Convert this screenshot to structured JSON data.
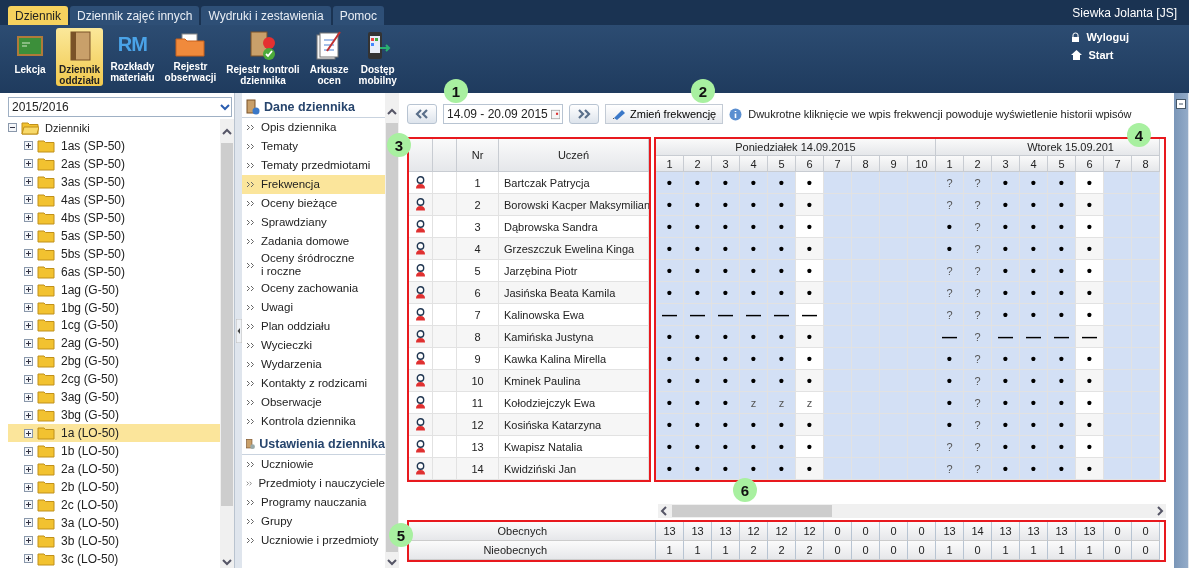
{
  "menu_tabs": [
    {
      "label": "Dziennik",
      "selected": true
    },
    {
      "label": "Dziennik zajęć innych",
      "selected": false
    },
    {
      "label": "Wydruki i zestawienia",
      "selected": false
    },
    {
      "label": "Pomoc",
      "selected": false
    }
  ],
  "user": {
    "name": "Siewka Jolanta [JS]",
    "links": [
      "Wyloguj",
      "Start"
    ]
  },
  "ribbon": [
    {
      "label_lines": [
        "Lekcja"
      ],
      "selected": false
    },
    {
      "label_lines": [
        "Dziennik",
        "oddziału"
      ],
      "selected": true
    },
    {
      "label_lines": [
        "Rozkłady",
        "materiału"
      ],
      "icon_text": "RM",
      "selected": false
    },
    {
      "label_lines": [
        "Rejestr",
        "obserwacji"
      ],
      "selected": false
    },
    {
      "label_lines": [
        "Rejestr kontroli",
        "dziennika"
      ],
      "selected": false
    },
    {
      "label_lines": [
        "Arkusze",
        "ocen"
      ],
      "selected": false
    },
    {
      "label_lines": [
        "Dostęp",
        "mobilny"
      ],
      "selected": false
    }
  ],
  "year_select": {
    "value": "2015/2016"
  },
  "tree": {
    "label": "Dzienniki",
    "expanded": true,
    "children": [
      {
        "label": "1as (SP-50)",
        "expanded": false,
        "selected": false
      },
      {
        "label": "2as (SP-50)",
        "expanded": false,
        "selected": false
      },
      {
        "label": "3as (SP-50)",
        "expanded": false,
        "selected": false
      },
      {
        "label": "4as (SP-50)",
        "expanded": false,
        "selected": false
      },
      {
        "label": "4bs (SP-50)",
        "expanded": false,
        "selected": false
      },
      {
        "label": "5as (SP-50)",
        "expanded": false,
        "selected": false
      },
      {
        "label": "5bs (SP-50)",
        "expanded": false,
        "selected": false
      },
      {
        "label": "6as (SP-50)",
        "expanded": false,
        "selected": false
      },
      {
        "label": "1ag (G-50)",
        "expanded": false,
        "selected": false
      },
      {
        "label": "1bg (G-50)",
        "expanded": false,
        "selected": false
      },
      {
        "label": "1cg (G-50)",
        "expanded": false,
        "selected": false
      },
      {
        "label": "2ag (G-50)",
        "expanded": false,
        "selected": false
      },
      {
        "label": "2bg (G-50)",
        "expanded": false,
        "selected": false
      },
      {
        "label": "2cg (G-50)",
        "expanded": false,
        "selected": false
      },
      {
        "label": "3ag (G-50)",
        "expanded": false,
        "selected": false
      },
      {
        "label": "3bg (G-50)",
        "expanded": false,
        "selected": false
      },
      {
        "label": "1a (LO-50)",
        "expanded": false,
        "selected": true
      },
      {
        "label": "1b (LO-50)",
        "expanded": false,
        "selected": false
      },
      {
        "label": "2a (LO-50)",
        "expanded": false,
        "selected": false
      },
      {
        "label": "2b (LO-50)",
        "expanded": false,
        "selected": false
      },
      {
        "label": "2c (LO-50)",
        "expanded": false,
        "selected": false
      },
      {
        "label": "3a (LO-50)",
        "expanded": false,
        "selected": false
      },
      {
        "label": "3b (LO-50)",
        "expanded": false,
        "selected": false
      },
      {
        "label": "3c (LO-50)",
        "expanded": false,
        "selected": false
      }
    ]
  },
  "nav_sections": [
    {
      "title": "Dane dziennika",
      "items": [
        {
          "label_lines": [
            "Opis dziennika"
          ],
          "selected": false
        },
        {
          "label_lines": [
            "Tematy"
          ],
          "selected": false
        },
        {
          "label_lines": [
            "Tematy przedmiotami"
          ],
          "selected": false
        },
        {
          "label_lines": [
            "Frekwencja"
          ],
          "selected": true
        },
        {
          "label_lines": [
            "Oceny bieżące"
          ],
          "selected": false
        },
        {
          "label_lines": [
            "Sprawdziany"
          ],
          "selected": false
        },
        {
          "label_lines": [
            "Zadania domowe"
          ],
          "selected": false
        },
        {
          "label_lines": [
            "Oceny śródroczne",
            "i roczne"
          ],
          "selected": false
        },
        {
          "label_lines": [
            "Oceny zachowania"
          ],
          "selected": false
        },
        {
          "label_lines": [
            "Uwagi"
          ],
          "selected": false
        },
        {
          "label_lines": [
            "Plan oddziału"
          ],
          "selected": false
        },
        {
          "label_lines": [
            "Wycieczki"
          ],
          "selected": false
        },
        {
          "label_lines": [
            "Wydarzenia"
          ],
          "selected": false
        },
        {
          "label_lines": [
            "Kontakty z rodzicami"
          ],
          "selected": false
        },
        {
          "label_lines": [
            "Obserwacje"
          ],
          "selected": false
        },
        {
          "label_lines": [
            "Kontrola dziennika"
          ],
          "selected": false
        }
      ]
    },
    {
      "title": "Ustawienia dziennika",
      "items": [
        {
          "label_lines": [
            "Uczniowie"
          ],
          "selected": false
        },
        {
          "label_lines": [
            "Przedmioty i nauczyciele"
          ],
          "selected": false
        },
        {
          "label_lines": [
            "Programy nauczania"
          ],
          "selected": false
        },
        {
          "label_lines": [
            "Grupy"
          ],
          "selected": false
        },
        {
          "label_lines": [
            "Uczniowie i przedmioty"
          ],
          "selected": false
        }
      ]
    }
  ],
  "toolbar": {
    "date_range": "14.09 - 20.09 2015",
    "change_button": "Zmień frekwencję",
    "info": "Dwukrotne kliknięcie we wpis frekwencji powoduje wyświetlenie historii wpisów"
  },
  "students_header": {
    "nr": "Nr",
    "name": "Uczeń"
  },
  "days": [
    {
      "label": "Poniedziałek 14.09.2015",
      "lessons": [
        {
          "label": "1",
          "shaded": true
        },
        {
          "label": "2",
          "shaded": true
        },
        {
          "label": "3",
          "shaded": true
        },
        {
          "label": "4",
          "shaded": true
        },
        {
          "label": "5",
          "shaded": true
        },
        {
          "label": "6",
          "shaded": false
        },
        {
          "label": "7",
          "shaded": true
        },
        {
          "label": "8",
          "shaded": true
        },
        {
          "label": "9",
          "shaded": true
        },
        {
          "label": "10",
          "shaded": true
        }
      ]
    },
    {
      "label": "Wtorek 15.09.201",
      "lessons": [
        {
          "label": "1",
          "shaded": true
        },
        {
          "label": "2",
          "shaded": true
        },
        {
          "label": "3",
          "shaded": true
        },
        {
          "label": "4",
          "shaded": true
        },
        {
          "label": "5",
          "shaded": true
        },
        {
          "label": "6",
          "shaded": false
        },
        {
          "label": "7",
          "shaded": true
        },
        {
          "label": "8",
          "shaded": true
        }
      ]
    }
  ],
  "rows": [
    {
      "nr": "1",
      "name": "Bartczak Patrycja",
      "marks": [
        [
          "•",
          "•",
          "•",
          "•",
          "•",
          "•"
        ],
        [
          "?",
          "?",
          "•",
          "•",
          "•",
          "•"
        ]
      ]
    },
    {
      "nr": "2",
      "name": "Borowski Kacper Maksymilian",
      "marks": [
        [
          "•",
          "•",
          "•",
          "•",
          "•",
          "•"
        ],
        [
          "?",
          "?",
          "•",
          "•",
          "•",
          "•"
        ]
      ]
    },
    {
      "nr": "3",
      "name": "Dąbrowska Sandra",
      "marks": [
        [
          "•",
          "•",
          "•",
          "•",
          "•",
          "•"
        ],
        [
          "•",
          "?",
          "•",
          "•",
          "•",
          "•"
        ]
      ]
    },
    {
      "nr": "4",
      "name": "Grzeszczuk Ewelina Kinga",
      "marks": [
        [
          "•",
          "•",
          "•",
          "•",
          "•",
          "•"
        ],
        [
          "•",
          "?",
          "•",
          "•",
          "•",
          "•"
        ]
      ]
    },
    {
      "nr": "5",
      "name": "Jarzębina Piotr",
      "marks": [
        [
          "•",
          "•",
          "•",
          "•",
          "•",
          "•"
        ],
        [
          "?",
          "?",
          "•",
          "•",
          "•",
          "•"
        ]
      ]
    },
    {
      "nr": "6",
      "name": "Jasińska Beata Kamila",
      "marks": [
        [
          "•",
          "•",
          "•",
          "•",
          "•",
          "•"
        ],
        [
          "?",
          "?",
          "•",
          "•",
          "•",
          "•"
        ]
      ]
    },
    {
      "nr": "7",
      "name": "Kalinowska Ewa",
      "marks": [
        [
          "—",
          "—",
          "—",
          "—",
          "—",
          "—"
        ],
        [
          "?",
          "?",
          "•",
          "•",
          "•",
          "•"
        ]
      ]
    },
    {
      "nr": "8",
      "name": "Kamińska Justyna",
      "marks": [
        [
          "•",
          "•",
          "•",
          "•",
          "•",
          "•"
        ],
        [
          "—",
          "?",
          "—",
          "—",
          "—",
          "—"
        ]
      ]
    },
    {
      "nr": "9",
      "name": "Kawka Kalina Mirella",
      "marks": [
        [
          "•",
          "•",
          "•",
          "•",
          "•",
          "•"
        ],
        [
          "•",
          "?",
          "•",
          "•",
          "•",
          "•"
        ]
      ]
    },
    {
      "nr": "10",
      "name": "Kminek Paulina",
      "marks": [
        [
          "•",
          "•",
          "•",
          "•",
          "•",
          "•"
        ],
        [
          "•",
          "?",
          "•",
          "•",
          "•",
          "•"
        ]
      ]
    },
    {
      "nr": "11",
      "name": "Kołodziejczyk Ewa",
      "marks": [
        [
          "•",
          "•",
          "•",
          "z",
          "z",
          "z"
        ],
        [
          "•",
          "?",
          "•",
          "•",
          "•",
          "•"
        ]
      ]
    },
    {
      "nr": "12",
      "name": "Kosińska Katarzyna",
      "marks": [
        [
          "•",
          "•",
          "•",
          "•",
          "•",
          "•"
        ],
        [
          "•",
          "?",
          "•",
          "•",
          "•",
          "•"
        ]
      ]
    },
    {
      "nr": "13",
      "name": "Kwapisz Natalia",
      "marks": [
        [
          "•",
          "•",
          "•",
          "•",
          "•",
          "•"
        ],
        [
          "?",
          "?",
          "•",
          "•",
          "•",
          "•"
        ]
      ]
    },
    {
      "nr": "14",
      "name": "Kwidziński Jan",
      "marks": [
        [
          "•",
          "•",
          "•",
          "•",
          "•",
          "•"
        ],
        [
          "?",
          "?",
          "•",
          "•",
          "•",
          "•"
        ]
      ]
    }
  ],
  "totals": [
    {
      "label": "Obecnych",
      "values": [
        "13",
        "13",
        "13",
        "12",
        "12",
        "12",
        "0",
        "0",
        "0",
        "0",
        "13",
        "14",
        "13",
        "13",
        "13",
        "13",
        "0",
        "0"
      ]
    },
    {
      "label": "Nieobecnych",
      "values": [
        "1",
        "1",
        "1",
        "2",
        "2",
        "2",
        "0",
        "0",
        "0",
        "0",
        "1",
        "0",
        "1",
        "1",
        "1",
        "1",
        "0",
        "0"
      ]
    }
  ],
  "callouts": [
    "1",
    "2",
    "3",
    "4",
    "5",
    "6"
  ]
}
